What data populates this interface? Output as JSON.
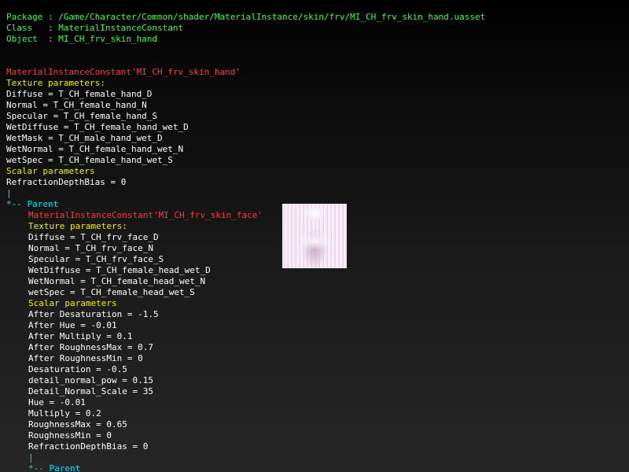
{
  "colors": {
    "green": "#3cff3c",
    "red": "#ff3b3b",
    "yellow": "#f0f000",
    "cyan": "#00e5ff",
    "text": "#ffffff"
  },
  "header": {
    "package": "Package : /Game/Character/Common/shader/MaterialInstance/skin/frv/MI_CH_frv_skin_hand.uasset",
    "class": "Class   : MaterialInstanceConstant",
    "object": "Object  : MI_CH_frv_skin_hand"
  },
  "material": {
    "name": "MaterialInstanceConstant'MI_CH_frv_skin_hand'",
    "texture_header": "Texture parameters:",
    "textures": [
      "Diffuse = T_CH_female_hand_D",
      "Normal = T_CH_female_hand_N",
      "Specular = T_CH_female_hand_S",
      "WetDiffuse = T_CH_female_hand_wet_D",
      "WetMask = T_CH_male_hand_wet_D",
      "WetNormal = T_CH_female_hand_wet_N",
      "wetSpec = T_CH_female_hand_wet_S"
    ],
    "scalar_header": "Scalar parameters",
    "scalars": [
      "RefractionDepthBias = 0"
    ]
  },
  "tree": {
    "pipe": "|",
    "parent_label": "*-- Parent"
  },
  "parent": {
    "name": "MaterialInstanceConstant'MI_CH_frv_skin_face'",
    "thumbnail_icon": "texture-thumbnail",
    "texture_header": "Texture parameters:",
    "textures": [
      "Diffuse = T_CH_frv_face_D",
      "Normal = T_CH_frv_face_N",
      "Specular = T_CH_frv_face_S",
      "WetDiffuse = T_CH_female_head_wet_D",
      "WetNormal = T_CH_female_head_wet_N",
      "wetSpec = T_CH_female_head_wet_S"
    ],
    "scalar_header": "Scalar parameters",
    "scalars": [
      "After Desaturation = -1.5",
      "After Hue = -0.01",
      "After Multiply = 0.1",
      "After RoughnessMax = 0.7",
      "After RoughnessMin = 0",
      "Desaturation = -0.5",
      "detail_normal_pow = 0.15",
      "Detail_Normal_Scale = 35",
      "Hue = -0.01",
      "Multiply = 0.2",
      "RoughnessMax = 0.65",
      "RoughnessMin = 0",
      "RefractionDepthBias = 0"
    ]
  }
}
